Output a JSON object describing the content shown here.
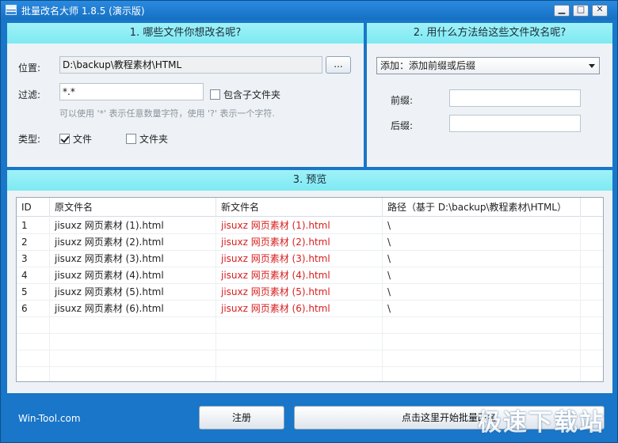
{
  "window": {
    "title": "批量改名大师 1.8.5 (演示版)"
  },
  "section1": {
    "header": "1. 哪些文件你想改名呢?",
    "location_label": "位置:",
    "location_value": "D:\\backup\\教程素材\\HTML",
    "browse_label": "...",
    "filter_label": "过滤:",
    "filter_value": "*.*",
    "include_subfolders_label": "包含子文件夹",
    "include_subfolders_checked": false,
    "hint": "可以使用 '*' 表示任意数量字符，使用 '?' 表示一个字符.",
    "type_label": "类型:",
    "type_file_label": "文件",
    "type_file_checked": true,
    "type_folder_label": "文件夹",
    "type_folder_checked": false
  },
  "section2": {
    "header": "2. 用什么方法给这些文件改名呢?",
    "method_selected": "添加：添加前缀或后缀",
    "prefix_label": "前缀:",
    "prefix_value": "",
    "suffix_label": "后缀:",
    "suffix_value": ""
  },
  "section3": {
    "header": "3. 预览",
    "columns": [
      "ID",
      "原文件名",
      "新文件名",
      "路径（基于 D:\\backup\\教程素材\\HTML）"
    ],
    "rows": [
      {
        "id": "1",
        "original": "jisuxz 网页素材 (1).html",
        "new": "jisuxz 网页素材 (1).html",
        "path": "\\"
      },
      {
        "id": "2",
        "original": "jisuxz 网页素材 (2).html",
        "new": "jisuxz 网页素材 (2).html",
        "path": "\\"
      },
      {
        "id": "3",
        "original": "jisuxz 网页素材 (3).html",
        "new": "jisuxz 网页素材 (3).html",
        "path": "\\"
      },
      {
        "id": "4",
        "original": "jisuxz 网页素材 (4).html",
        "new": "jisuxz 网页素材 (4).html",
        "path": "\\"
      },
      {
        "id": "5",
        "original": "jisuxz 网页素材 (5).html",
        "new": "jisuxz 网页素材 (5).html",
        "path": "\\"
      },
      {
        "id": "6",
        "original": "jisuxz 网页素材 (6).html",
        "new": "jisuxz 网页素材 (6).html",
        "path": "\\"
      }
    ]
  },
  "footer": {
    "site_link": "Win-Tool.com",
    "register_label": "注册",
    "start_label": "点击这里开始批量改名"
  },
  "watermark": "极速下载站",
  "colors": {
    "accent": "#1976c8",
    "header_bg": "#8ff0f6",
    "new_name": "#d81e1e"
  },
  "icons": {
    "app": "app-icon",
    "minimize": "minimize-icon",
    "maximize": "maximize-icon",
    "close": "close-icon",
    "dropdown": "chevron-down-icon"
  }
}
